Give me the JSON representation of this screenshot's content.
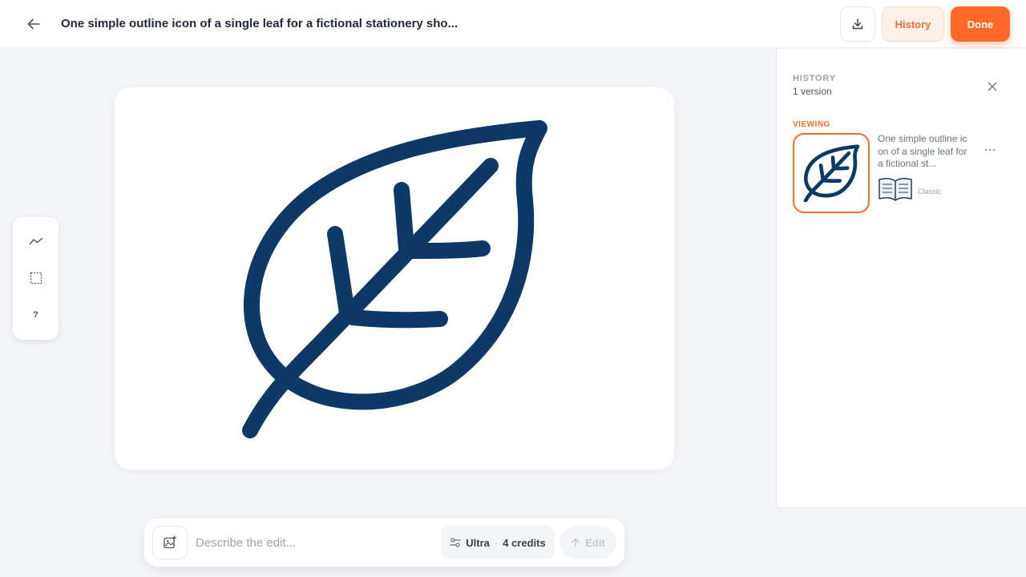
{
  "header": {
    "title": "One simple outline icon of a single leaf for a fictional stationery sho...",
    "history_label": "History",
    "done_label": "Done"
  },
  "tools": [
    {
      "icon": "stroke-icon"
    },
    {
      "icon": "selection-icon"
    },
    {
      "label": "?",
      "icon": "help-icon"
    }
  ],
  "prompt": {
    "placeholder": "Describe the edit...",
    "model": "Ultra",
    "credits": "4 credits",
    "edit_label": "Edit"
  },
  "history_panel": {
    "heading": "HISTORY",
    "count": "1 version",
    "viewing_label": "VIEWING",
    "versions": [
      {
        "description": "One simple outline icon of a single leaf for a fictional st...",
        "style": "Classic"
      }
    ]
  },
  "colors": {
    "accent": "#ff6a2b",
    "leaf_stroke": "#0e3866",
    "background": "#f4f5f8"
  }
}
